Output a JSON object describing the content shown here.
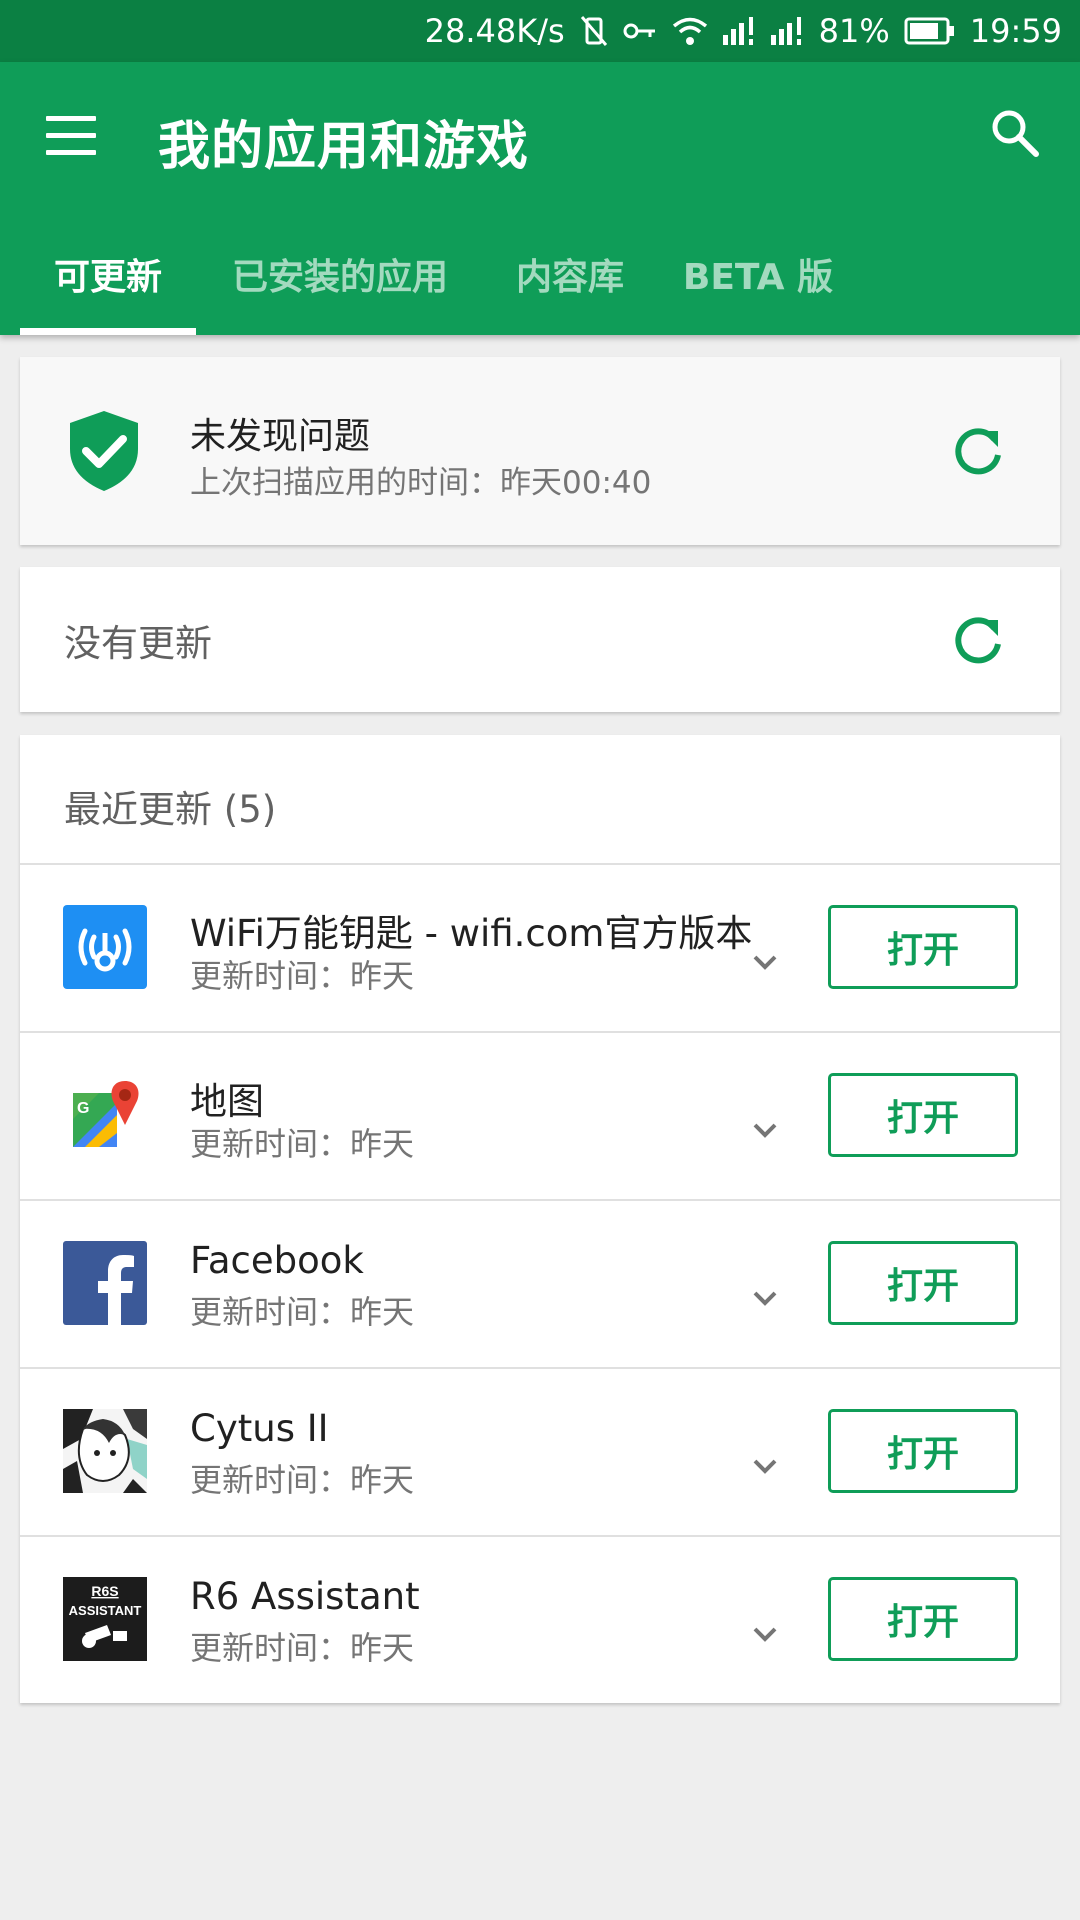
{
  "status_bar": {
    "net_speed": "28.48K/s",
    "battery": "81%",
    "time": "19:59"
  },
  "app_bar": {
    "title": "我的应用和游戏"
  },
  "tabs": [
    {
      "label": "可更新",
      "active": true
    },
    {
      "label": "已安装的应用",
      "active": false
    },
    {
      "label": "内容库",
      "active": false
    },
    {
      "label": "BETA 版",
      "active": false
    }
  ],
  "security": {
    "title": "未发现问题",
    "subtitle": "上次扫描应用的时间：昨天00:40"
  },
  "updates": {
    "text": "没有更新"
  },
  "recent": {
    "header": "最近更新 (5)",
    "apps": [
      {
        "name": "WiFi万能钥匙 - wifi.com官方版本",
        "time": "更新时间：昨天",
        "button": "打开",
        "icon": "wifi-master-key-icon"
      },
      {
        "name": "地图",
        "time": "更新时间：昨天",
        "button": "打开",
        "icon": "google-maps-icon"
      },
      {
        "name": "Facebook",
        "time": "更新时间：昨天",
        "button": "打开",
        "icon": "facebook-icon"
      },
      {
        "name": "Cytus II",
        "time": "更新时间：昨天",
        "button": "打开",
        "icon": "cytus-icon"
      },
      {
        "name": "R6 Assistant",
        "time": "更新时间：昨天",
        "button": "打开",
        "icon": "r6-assistant-icon",
        "icon_text": [
          "R6S",
          "ASSISTANT"
        ]
      }
    ]
  },
  "colors": {
    "status_bar": "#0b8043",
    "primary": "#0f9d58",
    "background": "#eeeeee"
  }
}
